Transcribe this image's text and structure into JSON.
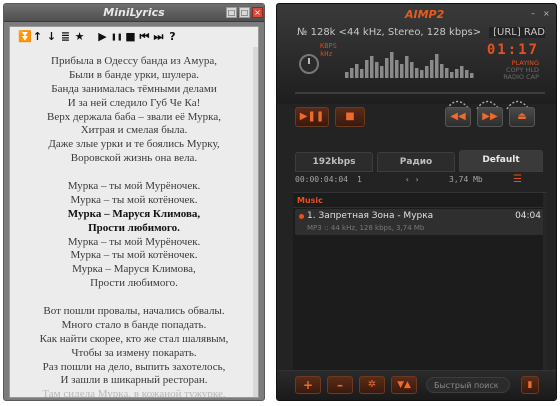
{
  "minilyrics": {
    "title": "MiniLyrics",
    "window_buttons": [
      "□",
      "□",
      "×"
    ],
    "toolbar_icons": [
      {
        "name": "double-down-icon",
        "glyph": "⏬"
      },
      {
        "name": "arrow-up-icon",
        "glyph": "↑"
      },
      {
        "name": "arrow-down-icon",
        "glyph": "↓"
      },
      {
        "name": "lyrics-file-icon",
        "glyph": "≣"
      },
      {
        "name": "star-icon",
        "glyph": "★"
      },
      {
        "name": "play-icon",
        "glyph": "▶"
      },
      {
        "name": "pause-icon",
        "glyph": "❚❚"
      },
      {
        "name": "stop-icon",
        "glyph": "■"
      },
      {
        "name": "previous-icon",
        "glyph": "⏮"
      },
      {
        "name": "next-icon",
        "glyph": "⏭"
      },
      {
        "name": "help-icon",
        "glyph": "?"
      }
    ],
    "lyrics": [
      {
        "text": "Прибыла в Одессу банда из Амура,",
        "style": "normal"
      },
      {
        "text": "Были в банде урки, шулера.",
        "style": "normal"
      },
      {
        "text": "Банда занималась тёмными делами",
        "style": "normal"
      },
      {
        "text": "И за ней следило Губ Че Ка!",
        "style": "normal"
      },
      {
        "text": "Верх держала баба – звали её Мурка,",
        "style": "normal"
      },
      {
        "text": "Хитрая и смелая была.",
        "style": "normal"
      },
      {
        "text": "Даже злые урки и те боялись Мурку,",
        "style": "normal"
      },
      {
        "text": "Воровской жизнь она вела.",
        "style": "normal"
      },
      {
        "text": "",
        "style": "normal"
      },
      {
        "text": "Мурка – ты мой Мурёночек.",
        "style": "normal"
      },
      {
        "text": "Мурка – ты мой котёночек.",
        "style": "normal"
      },
      {
        "text": "Мурка – Маруся Климова,",
        "style": "hl"
      },
      {
        "text": "Прости любимого.",
        "style": "hl"
      },
      {
        "text": "Мурка – ты мой Мурёночек.",
        "style": "normal"
      },
      {
        "text": "Мурка – ты мой котёночек.",
        "style": "normal"
      },
      {
        "text": "Мурка – Маруся Климова,",
        "style": "normal"
      },
      {
        "text": "Прости любимого.",
        "style": "normal"
      },
      {
        "text": "",
        "style": "normal"
      },
      {
        "text": "Вот пошли провалы, начались обвалы.",
        "style": "normal"
      },
      {
        "text": "Много стало в банде попадать.",
        "style": "normal"
      },
      {
        "text": "Как найти скорее, кто же стал шалявым,",
        "style": "normal"
      },
      {
        "text": "Чтобы за измену покарать.",
        "style": "normal"
      },
      {
        "text": "Раз пошли на дело, выпить захотелось,",
        "style": "normal"
      },
      {
        "text": "И зашли в шикарный ресторан.",
        "style": "normal"
      },
      {
        "text": "Там сидела Мурка, в кожаной тужурке,",
        "style": "dim"
      }
    ]
  },
  "aimp": {
    "logo": "AIMP2",
    "window_buttons": [
      "–",
      "×"
    ],
    "stream_info": "128k <44 kHz, Stereo, 128 kbps>",
    "stream_info_prefix": "№",
    "url_label": "[URL] RAD",
    "kbps_label": "KBPS",
    "khz_label": "kHz",
    "time": "01:17",
    "status_on": "PLAYING",
    "status_items": [
      "COPY HLD",
      "RADIO CAP"
    ],
    "transport": {
      "play_pause": "▶❚❚",
      "stop": "■"
    },
    "nav": {
      "prev": "◀◀",
      "next": "▶▶",
      "eject": "⏏"
    },
    "tabs": [
      {
        "label": "192kbps",
        "active": false
      },
      {
        "label": "Радио",
        "active": false
      },
      {
        "label": "Default",
        "active": true
      }
    ],
    "playlist_info": {
      "duration": "00:00:04:04",
      "count": "1",
      "arrows": "‹  ›",
      "size": "3,74 Mb",
      "menu_icon": "☰"
    },
    "group": "Music",
    "tracks": [
      {
        "title": "1. Запретная Зона - Мурка",
        "duration": "04:04",
        "meta": "MP3 :: 44 kHz, 128 kbps, 3,74 Mb"
      }
    ],
    "bottom_buttons": {
      "add": "+",
      "remove": "–",
      "sort": "✲",
      "misc": "▼▲"
    },
    "search_placeholder": "Быстрый поиск",
    "colors": {
      "accent": "#e8501e",
      "background": "#232323"
    }
  }
}
